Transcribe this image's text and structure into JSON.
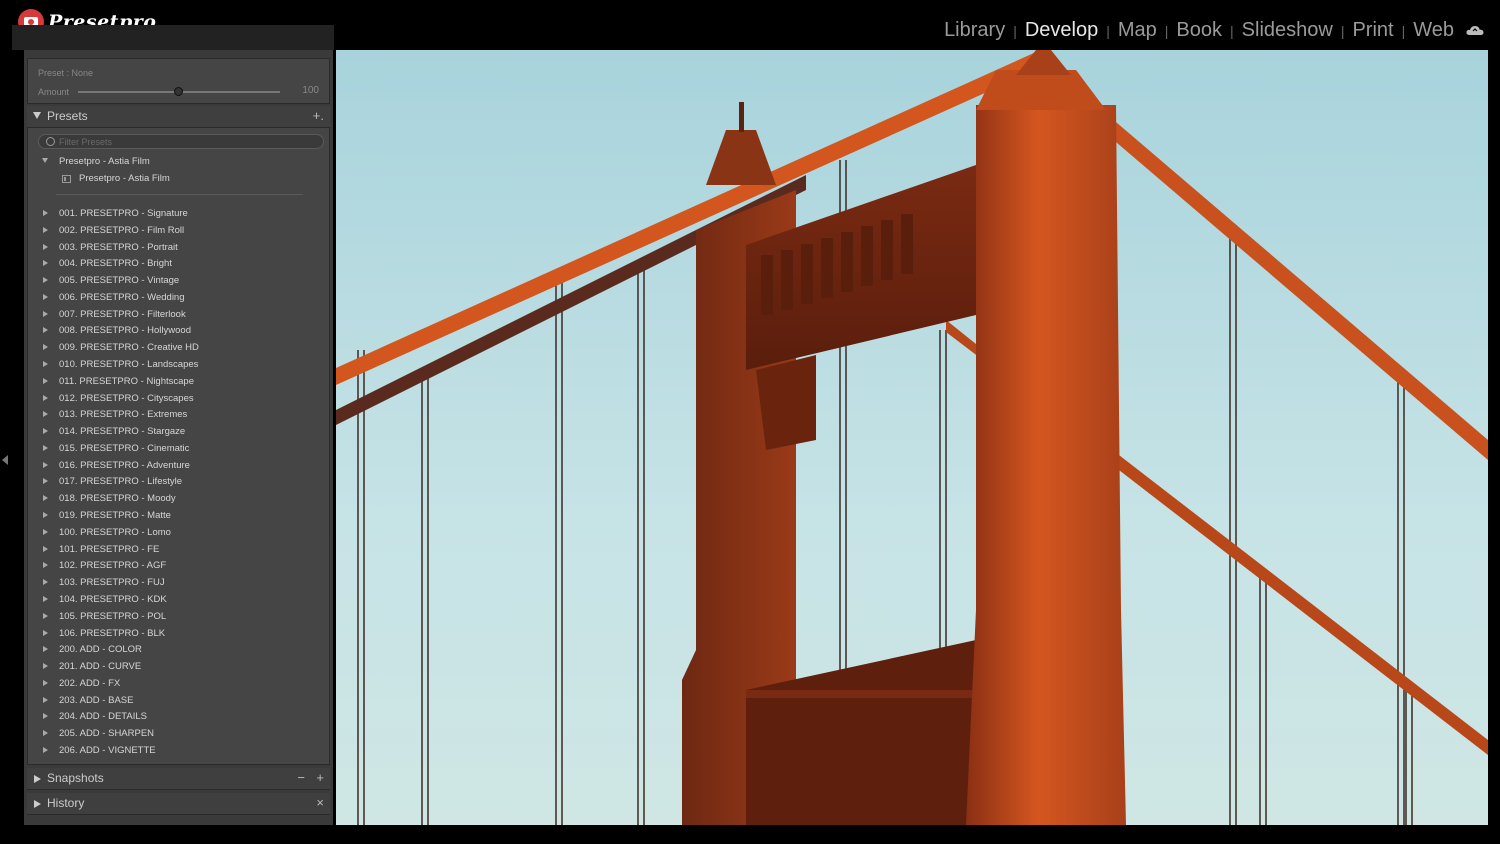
{
  "app": {
    "logo_text": "Presetpro",
    "brand_color": "#d63a3a"
  },
  "modules": [
    {
      "label": "Library",
      "active": false
    },
    {
      "label": "Develop",
      "active": true
    },
    {
      "label": "Map",
      "active": false
    },
    {
      "label": "Book",
      "active": false
    },
    {
      "label": "Slideshow",
      "active": false
    },
    {
      "label": "Print",
      "active": false
    },
    {
      "label": "Web",
      "active": false
    }
  ],
  "module_separator": "|",
  "preset_amount": {
    "preset_label": "Preset : None",
    "amount_label": "Amount",
    "amount_value": "100",
    "amount_level": 0.5
  },
  "presets_panel": {
    "title": "Presets",
    "add_button": "+.",
    "filter_placeholder": "Filter Presets",
    "open_group": {
      "name": "Presetpro - Astia Film",
      "child": "Presetpro - Astia Film"
    },
    "groups": [
      "001. PRESETPRO - Signature",
      "002. PRESETPRO - Film Roll",
      "003. PRESETPRO - Portrait",
      "004. PRESETPRO - Bright",
      "005. PRESETPRO - Vintage",
      "006. PRESETPRO - Wedding",
      "007. PRESETPRO - Filterlook",
      "008. PRESETPRO - Hollywood",
      "009. PRESETPRO - Creative HD",
      "010. PRESETPRO - Landscapes",
      "011. PRESETPRO - Nightscape",
      "012. PRESETPRO - Cityscapes",
      "013. PRESETPRO - Extremes",
      "014. PRESETPRO - Stargaze",
      "015. PRESETPRO - Cinematic",
      "016. PRESETPRO - Adventure",
      "017. PRESETPRO - Lifestyle",
      "018. PRESETPRO - Moody",
      "019. PRESETPRO - Matte",
      "100. PRESETPRO - Lomo",
      "101. PRESETPRO - FE",
      "102. PRESETPRO - AGF",
      "103. PRESETPRO - FUJ",
      "104. PRESETPRO - KDK",
      "105. PRESETPRO - POL",
      "106. PRESETPRO - BLK",
      "200. ADD - COLOR",
      "201. ADD - CURVE",
      "202. ADD - FX",
      "203. ADD - BASE",
      "204. ADD - DETAILS",
      "205. ADD - SHARPEN",
      "206. ADD - VIGNETTE"
    ]
  },
  "snapshots_panel": {
    "title": "Snapshots",
    "minus": "−",
    "plus": "+"
  },
  "history_panel": {
    "title": "History",
    "close": "×"
  },
  "photo": {
    "subject": "bridge-tower-photo"
  }
}
